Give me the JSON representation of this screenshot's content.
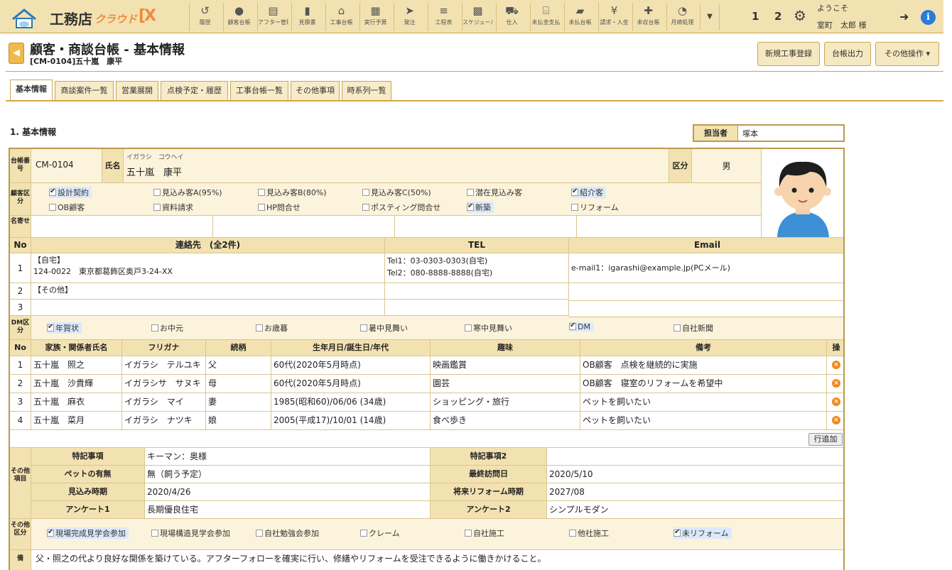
{
  "app": {
    "name": "工務店",
    "sub": "クラウド",
    "x": "[X"
  },
  "nav": [
    {
      "label": "履歴",
      "icon": "history-icon",
      "glyph": "↺"
    },
    {
      "label": "顧客台帳",
      "icon": "user-icon",
      "glyph": "●"
    },
    {
      "label": "アフター管理",
      "icon": "monitor-icon",
      "glyph": "▤"
    },
    {
      "label": "見積書",
      "icon": "file-icon",
      "glyph": "▮"
    },
    {
      "label": "工事台帳",
      "icon": "home-icon",
      "glyph": "⌂"
    },
    {
      "label": "実行予算",
      "icon": "calculator-icon",
      "glyph": "▦"
    },
    {
      "label": "発注",
      "icon": "send-icon",
      "glyph": "➤"
    },
    {
      "label": "工程表",
      "icon": "schedule-icon",
      "glyph": "≡"
    },
    {
      "label": "スケジュール",
      "icon": "calendar-icon",
      "glyph": "▩"
    },
    {
      "label": "仕入",
      "icon": "cart-icon",
      "glyph": "⛟"
    },
    {
      "label": "未払金支払",
      "icon": "bank-icon",
      "glyph": "⌸"
    },
    {
      "label": "未払台帳",
      "icon": "truck-icon",
      "glyph": "▰"
    },
    {
      "label": "請求・入金",
      "icon": "invoice-icon",
      "glyph": "¥"
    },
    {
      "label": "未収台帳",
      "icon": "gift-icon",
      "glyph": "✚"
    },
    {
      "label": "月締処理",
      "icon": "gauge-icon",
      "glyph": "◔"
    }
  ],
  "user": {
    "n1": "1",
    "n2": "2",
    "welcome": "ようこそ",
    "name": "室町　太郎 様"
  },
  "title": {
    "main": "顧客・商談台帳 - 基本情報",
    "sub": "[CM-0104]五十嵐　康平"
  },
  "actions": {
    "new_work": "新規工事登録",
    "ledger_out": "台帳出力",
    "other_ops": "その他操作"
  },
  "tabs": [
    "基本情報",
    "商談案件一覧",
    "営業展開",
    "点検予定・履歴",
    "工事台帳一覧",
    "その他事項",
    "時系列一覧"
  ],
  "section": {
    "title": "1. 基本情報",
    "staff_label": "担当者",
    "staff_value": "塚本"
  },
  "basic": {
    "no_label": "台帳番号",
    "no_value": "CM-0104",
    "name_label": "氏名",
    "kana": "イガラシ　コウヘイ",
    "name": "五十嵐　康平",
    "kubun_label": "区分",
    "gender": "男",
    "cust_label": "顧客区分",
    "meishi_label": "名寄せ"
  },
  "cust_types": [
    {
      "label": "設計契約",
      "on": true
    },
    {
      "label": "見込み客A(95%)",
      "on": false
    },
    {
      "label": "見込み客B(80%)",
      "on": false
    },
    {
      "label": "見込み客C(50%)",
      "on": false
    },
    {
      "label": "潜在見込み客",
      "on": false
    },
    {
      "label": "紹介客",
      "on": true
    },
    {
      "label": "OB顧客",
      "on": false
    },
    {
      "label": "資料請求",
      "on": false
    },
    {
      "label": "HP問合せ",
      "on": false
    },
    {
      "label": "ポスティング問合せ",
      "on": false
    },
    {
      "label": "新築",
      "on": true
    },
    {
      "label": "リフォーム",
      "on": false
    }
  ],
  "contacts": {
    "h_no": "No",
    "h_addr": "連絡先　(全2件)",
    "h_tel": "TEL",
    "h_mail": "Email",
    "rows": [
      {
        "no": "1",
        "addr1": "【自宅】",
        "addr2": "124-0022　東京都葛飾区奥戸3-24-XX",
        "tel1": "Tel1：03-0303-0303(自宅)",
        "tel2": "Tel2：080-8888-8888(自宅)",
        "mail": "e-mail1：igarashi@example.jp(PCメール)"
      },
      {
        "no": "2",
        "addr1": "【その他】",
        "addr2": "",
        "tel1": "",
        "tel2": "",
        "mail": ""
      },
      {
        "no": "3",
        "addr1": "",
        "addr2": "",
        "tel1": "",
        "tel2": "",
        "mail": ""
      }
    ]
  },
  "dm_label": "DM区分",
  "dm": [
    {
      "label": "年賀状",
      "on": true
    },
    {
      "label": "お中元",
      "on": false
    },
    {
      "label": "お歳暮",
      "on": false
    },
    {
      "label": "暑中見舞い",
      "on": false
    },
    {
      "label": "寒中見舞い",
      "on": false
    },
    {
      "label": "DM",
      "on": true
    },
    {
      "label": "自社新聞",
      "on": false
    }
  ],
  "family": {
    "h": [
      "No",
      "家族・関係者氏名",
      "フリガナ",
      "続柄",
      "生年月日/誕生日/年代",
      "趣味",
      "備考",
      "操"
    ],
    "rows": [
      {
        "no": "1",
        "name": "五十嵐　照之",
        "kana": "イガラシ　テルユキ",
        "rel": "父",
        "birth": "60代(2020年5月時点)",
        "hobby": "映画鑑賞",
        "note": "OB顧客　点検を継続的に実施"
      },
      {
        "no": "2",
        "name": "五十嵐　沙貴輝",
        "kana": "イガラシサ　サヌキ",
        "rel": "母",
        "birth": "60代(2020年5月時点)",
        "hobby": "園芸",
        "note": "OB顧客　寝室のリフォームを希望中"
      },
      {
        "no": "3",
        "name": "五十嵐　麻衣",
        "kana": "イガラシ　マイ",
        "rel": "妻",
        "birth": "1985(昭和60)/06/06 (34歳)",
        "hobby": "ショッピング・旅行",
        "note": "ペットを飼いたい"
      },
      {
        "no": "4",
        "name": "五十嵐　菜月",
        "kana": "イガラシ　ナツキ",
        "rel": "娘",
        "birth": "2005(平成17)/10/01 (14歳)",
        "hobby": "食べ歩き",
        "note": "ペットを飼いたい"
      }
    ],
    "add_row": "行追加"
  },
  "other": {
    "label": "その他項目",
    "rows": [
      {
        "l1": "特記事項",
        "v1": "キーマン：奥様",
        "l2": "特記事項2",
        "v2": ""
      },
      {
        "l1": "ペットの有無",
        "v1": "無（飼う予定）",
        "l2": "最終訪問日",
        "v2": "2020/5/10"
      },
      {
        "l1": "見込み時期",
        "v1": "2020/4/26",
        "l2": "将来リフォーム時期",
        "v2": "2027/08"
      },
      {
        "l1": "アンケート1",
        "v1": "長期優良住宅",
        "l2": "アンケート2",
        "v2": "シンプルモダン"
      }
    ]
  },
  "other_kubun_label": "その他区分",
  "other_kubun": [
    {
      "label": "現場完成見学会参加",
      "on": true
    },
    {
      "label": "現場構造見学会参加",
      "on": false
    },
    {
      "label": "自社勉強会参加",
      "on": false
    },
    {
      "label": "クレーム",
      "on": false
    },
    {
      "label": "自社施工",
      "on": false
    },
    {
      "label": "他社施工",
      "on": false
    },
    {
      "label": "未リフォーム",
      "on": true
    }
  ],
  "memo": "父・照之の代より良好な関係を築けている。アフターフォローを確実に行い、修繕やリフォームを受注できるように働きかけること。"
}
